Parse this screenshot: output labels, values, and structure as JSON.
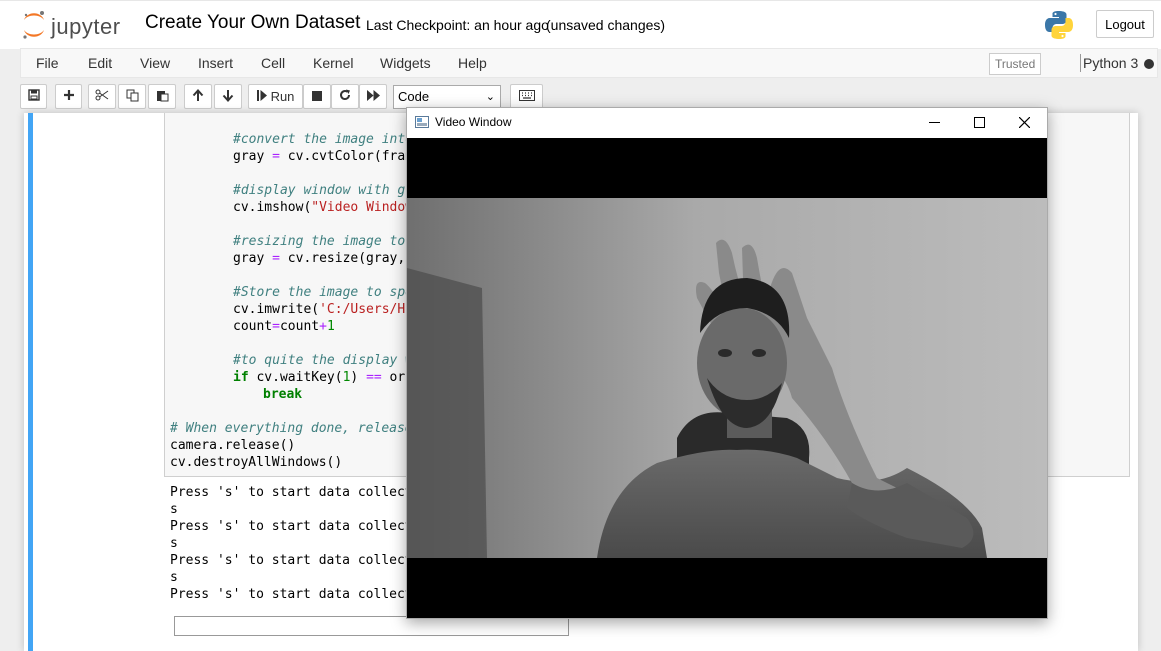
{
  "header": {
    "logo_text": "jupyter",
    "notebook_title": "Create Your Own Dataset",
    "checkpoint": "Last Checkpoint: an hour ago",
    "status": "(unsaved changes)",
    "logout_label": "Logout"
  },
  "menubar": {
    "items": [
      "File",
      "Edit",
      "View",
      "Insert",
      "Cell",
      "Kernel",
      "Widgets",
      "Help"
    ],
    "trusted_label": "Trusted",
    "kernel_name": "Python 3"
  },
  "toolbar": {
    "run_label": "Run",
    "cell_type": "Code",
    "icons": [
      "save-icon",
      "plus-icon",
      "cut-icon",
      "copy-icon",
      "paste-icon",
      "arrow-up-icon",
      "arrow-down-icon",
      "step-icon",
      "stop-icon",
      "restart-icon",
      "fast-forward-icon",
      "keyboard-icon"
    ]
  },
  "code": {
    "c1": "#convert the image into",
    "l1a": "gray ",
    "l1b": "=",
    "l1c": " cv.cvtColor(fram",
    "c2": "#display window with gr",
    "l2a": "cv.imshow(",
    "l2b": "\"Video Window",
    "c3": "#resizing the image to",
    "l3a": "gray ",
    "l3b": "=",
    "l3c": " cv.resize(gray,",
    "c4": "#Store the image to spe",
    "l4a": "cv.imwrite(",
    "l4b": "'C:/Users/HP",
    "l5a": "count",
    "l5b": "=",
    "l5c": "count",
    "l5d": "+",
    "l5e": "1",
    "c5": "#to quite the display w",
    "l6a": "if",
    "l6b": " cv.waitKey(",
    "l6c": "1",
    "l6d": ") ",
    "l6e": "==",
    "l6f": " ord",
    "l7": "break",
    "c6": "# When everything done, release",
    "l8": "camera.release()",
    "l9": "cv.destroyAllWindows()"
  },
  "output": {
    "lines": [
      "Press 's' to start data collect",
      "s",
      "Press 's' to start data collect",
      "s",
      "Press 's' to start data collect",
      "s",
      "Press 's' to start data collect"
    ]
  },
  "video_window": {
    "title": "Video Window"
  },
  "colors": {
    "jupyter_orange": "#f37726",
    "cell_selected_bar": "#42a5f5",
    "comment": "#408080",
    "string": "#ba2121",
    "keyword": "#008000",
    "operator": "#aa22ff"
  }
}
